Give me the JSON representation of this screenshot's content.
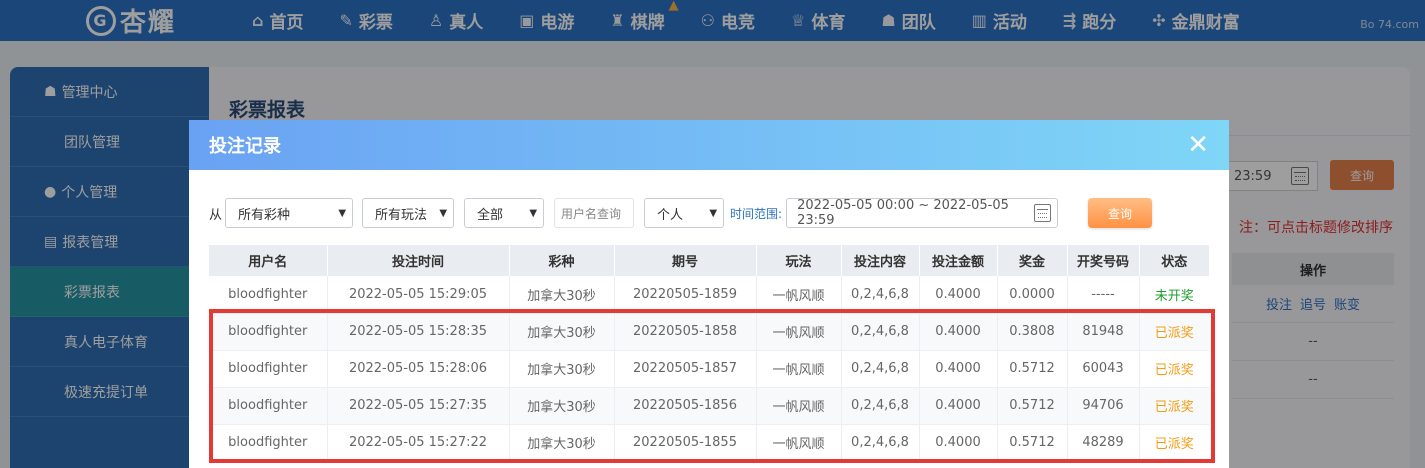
{
  "nav": {
    "logo_text": "杏耀",
    "logo_mark": "G",
    "items": [
      {
        "icon": "⌂",
        "label": "首页"
      },
      {
        "icon": "✎",
        "label": "彩票"
      },
      {
        "icon": "♙",
        "label": "真人"
      },
      {
        "icon": "▣",
        "label": "电游"
      },
      {
        "icon": "♜",
        "label": "棋牌"
      },
      {
        "icon": "⚇",
        "label": "电竞"
      },
      {
        "icon": "♕",
        "label": "体育"
      },
      {
        "icon": "☗",
        "label": "团队"
      },
      {
        "icon": "▥",
        "label": "活动"
      },
      {
        "icon": "⇶",
        "label": "跑分"
      },
      {
        "icon": "✣",
        "label": "金鼎财富"
      }
    ],
    "watermark": "Bo 74.com"
  },
  "sidebar": {
    "items": [
      {
        "type": "group",
        "icon": "☗",
        "label": "管理中心"
      },
      {
        "type": "sub",
        "label": "团队管理",
        "active": false
      },
      {
        "type": "group",
        "icon": "●",
        "label": "个人管理"
      },
      {
        "type": "group",
        "icon": "▤",
        "label": "报表管理"
      },
      {
        "type": "sub",
        "label": "彩票报表",
        "active": true
      },
      {
        "type": "sub",
        "label": "真人电子体育",
        "active": false
      },
      {
        "type": "sub",
        "label": "极速充提订单",
        "active": false
      }
    ]
  },
  "main": {
    "title": "彩票报表",
    "date_end": "23:59",
    "query_label": "查询",
    "note": "注：可点击标题修改排序",
    "ops_header": "操作",
    "ops_links": [
      "投注",
      "追号",
      "账变"
    ],
    "empty_rows": [
      "--",
      "--"
    ]
  },
  "modal": {
    "title": "投注记录",
    "close_icon": "✕",
    "filters": {
      "from_label": "从",
      "lottery": "所有彩种",
      "play": "所有玩法",
      "scope": "全部",
      "username_placeholder": "用户名查询",
      "person": "个人",
      "range_label": "时间范围:",
      "range_value": "2022-05-05 00:00 ~ 2022-05-05 23:59",
      "query_label": "查询"
    },
    "table": {
      "headers": [
        "用户名",
        "投注时间",
        "彩种",
        "期号",
        "玩法",
        "投注内容",
        "投注金额",
        "奖金",
        "开奖号码",
        "状态"
      ],
      "rows": [
        {
          "user": "bloodfighter",
          "time": "2022-05-05 15:29:05",
          "lottery": "加拿大30秒",
          "issue": "20220505-1859",
          "play": "一帆风顺",
          "content": "0,2,4,6,8",
          "amount": "0.4000",
          "prize": "0.0000",
          "draw": "-----",
          "status": "未开奖",
          "status_color": "#1f9c2e"
        },
        {
          "user": "bloodfighter",
          "time": "2022-05-05 15:28:35",
          "lottery": "加拿大30秒",
          "issue": "20220505-1858",
          "play": "一帆风顺",
          "content": "0,2,4,6,8",
          "amount": "0.4000",
          "prize": "0.3808",
          "draw": "81948",
          "status": "已派奖",
          "status_color": "#f39c12"
        },
        {
          "user": "bloodfighter",
          "time": "2022-05-05 15:28:06",
          "lottery": "加拿大30秒",
          "issue": "20220505-1857",
          "play": "一帆风顺",
          "content": "0,2,4,6,8",
          "amount": "0.4000",
          "prize": "0.5712",
          "draw": "60043",
          "status": "已派奖",
          "status_color": "#f39c12"
        },
        {
          "user": "bloodfighter",
          "time": "2022-05-05 15:27:35",
          "lottery": "加拿大30秒",
          "issue": "20220505-1856",
          "play": "一帆风顺",
          "content": "0,2,4,6,8",
          "amount": "0.4000",
          "prize": "0.5712",
          "draw": "94706",
          "status": "已派奖",
          "status_color": "#f39c12"
        },
        {
          "user": "bloodfighter",
          "time": "2022-05-05 15:27:22",
          "lottery": "加拿大30秒",
          "issue": "20220505-1855",
          "play": "一帆风顺",
          "content": "0,2,4,6,8",
          "amount": "0.4000",
          "prize": "0.5712",
          "draw": "48289",
          "status": "已派奖",
          "status_color": "#f39c12"
        }
      ]
    }
  },
  "colors": {
    "nav_bg": "#2d72c4",
    "sidebar_bg": "#2f6fb4",
    "sidebar_active": "#2694a3",
    "highlight_border": "#e53935"
  }
}
